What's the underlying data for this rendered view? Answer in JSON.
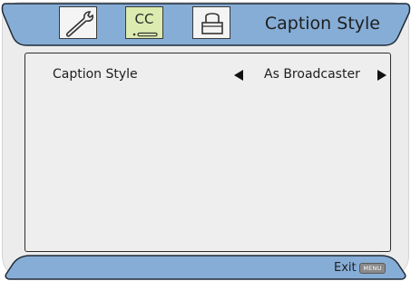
{
  "header": {
    "title": "Caption Style",
    "tabs": [
      {
        "id": "setup",
        "icon": "wrench-icon",
        "selected": false
      },
      {
        "id": "cc",
        "icon": "closed-caption-icon",
        "label": "CC",
        "selected": true
      },
      {
        "id": "lock",
        "icon": "lock-icon",
        "selected": false
      }
    ]
  },
  "content": {
    "rows": [
      {
        "label": "Caption Style",
        "value": "As Broadcaster"
      }
    ]
  },
  "footer": {
    "exit_label": "Exit",
    "menu_key": "MENU"
  },
  "colors": {
    "accent_blue": "#86add6",
    "selected_tab": "#dcebb0",
    "panel_bg": "#ececec"
  }
}
